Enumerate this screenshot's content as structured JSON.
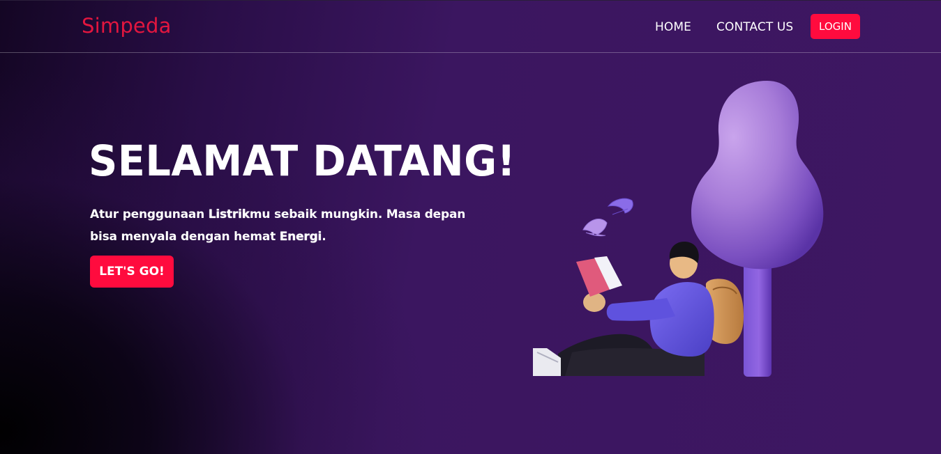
{
  "navbar": {
    "brand": "Simpeda",
    "links": [
      {
        "label": "HOME"
      },
      {
        "label": "CONTACT US"
      }
    ],
    "login_label": "LOGIN"
  },
  "hero": {
    "title": "SELAMAT DATANG!",
    "description": {
      "part1": "Atur penggunaan ",
      "highlight1": "Listrik",
      "part2": "mu sebaik mungkin. Masa depan bisa menyala dengan hemat ",
      "highlight2": "Energi",
      "part3": "."
    },
    "cta_label": "LET'S GO!"
  },
  "illustration": {
    "icon": "reading-person-under-tree-illustration"
  },
  "colors": {
    "brand": "#e3163f",
    "accent_button": "#ff0b3e",
    "background": "#3e1762",
    "text": "#ffffff"
  }
}
